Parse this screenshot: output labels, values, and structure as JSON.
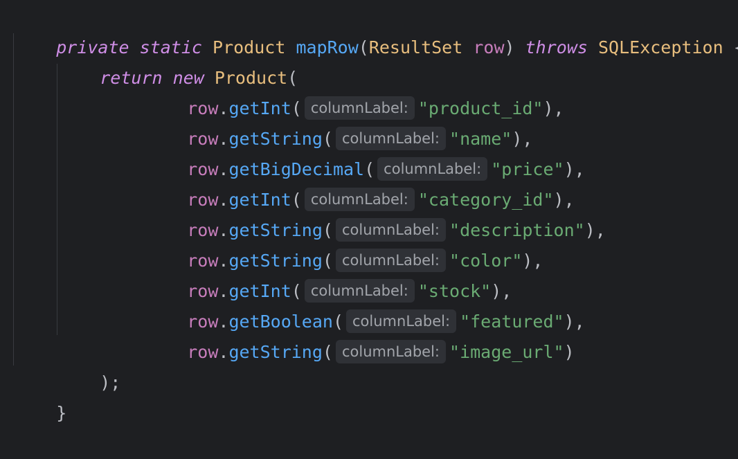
{
  "code": {
    "signature": {
      "private": "private",
      "static": "static",
      "return_type": "Product",
      "method": "mapRow",
      "open_paren": "(",
      "param_type": "ResultSet",
      "param_name": "row",
      "close_paren": ")",
      "throws": "throws",
      "exception": "SQLException",
      "brace": "{"
    },
    "return_line": {
      "return": "return",
      "new": "new",
      "class": "Product",
      "paren": "("
    },
    "calls": [
      {
        "obj": "row",
        "dot": ".",
        "method": "getInt",
        "open": "(",
        "hint": "columnLabel:",
        "arg": "\"product_id\"",
        "close": "),"
      },
      {
        "obj": "row",
        "dot": ".",
        "method": "getString",
        "open": "(",
        "hint": "columnLabel:",
        "arg": "\"name\"",
        "close": "),"
      },
      {
        "obj": "row",
        "dot": ".",
        "method": "getBigDecimal",
        "open": "(",
        "hint": "columnLabel:",
        "arg": "\"price\"",
        "close": "),"
      },
      {
        "obj": "row",
        "dot": ".",
        "method": "getInt",
        "open": "(",
        "hint": "columnLabel:",
        "arg": "\"category_id\"",
        "close": "),"
      },
      {
        "obj": "row",
        "dot": ".",
        "method": "getString",
        "open": "(",
        "hint": "columnLabel:",
        "arg": "\"description\"",
        "close": "),"
      },
      {
        "obj": "row",
        "dot": ".",
        "method": "getString",
        "open": "(",
        "hint": "columnLabel:",
        "arg": "\"color\"",
        "close": "),"
      },
      {
        "obj": "row",
        "dot": ".",
        "method": "getInt",
        "open": "(",
        "hint": "columnLabel:",
        "arg": "\"stock\"",
        "close": "),"
      },
      {
        "obj": "row",
        "dot": ".",
        "method": "getBoolean",
        "open": "(",
        "hint": "columnLabel:",
        "arg": "\"featured\"",
        "close": "),"
      },
      {
        "obj": "row",
        "dot": ".",
        "method": "getString",
        "open": "(",
        "hint": "columnLabel:",
        "arg": "\"image_url\"",
        "close": ")"
      }
    ],
    "close_paren_line": ");",
    "close_brace_line": "}"
  },
  "colors": {
    "background": "#1e1f22",
    "keyword": "#cf8ee6",
    "type": "#e8be7e",
    "method": "#56a8f5",
    "parameter": "#c77dbb",
    "string": "#6aab73",
    "hint_background": "#2f3136"
  }
}
